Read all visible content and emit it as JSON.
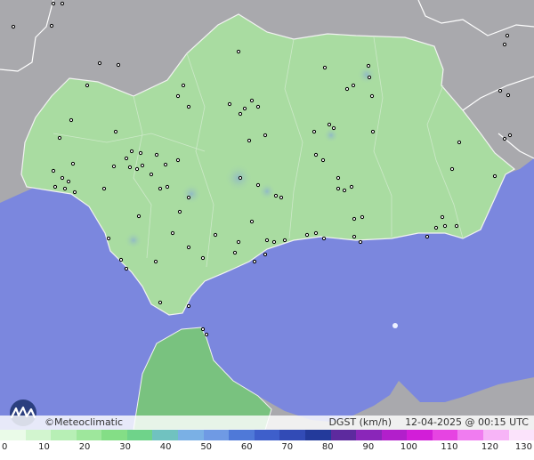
{
  "brand": "©Meteoclimatic",
  "parameter": "DGST (km/h)",
  "timestamp": "12-04-2025 @ 00:15 UTC",
  "colors": {
    "sea": "#7b87de",
    "land_outside": "#a9a9ad",
    "land_region": "#a9dca1",
    "land_region_dark": "#8fcb8c",
    "north_africa": "#79c27f",
    "station": "#000000"
  },
  "legend": {
    "ticks": [
      "0",
      "10",
      "20",
      "30",
      "40",
      "50",
      "60",
      "70",
      "80",
      "90",
      "100",
      "110",
      "120",
      "130"
    ],
    "colors": [
      "#eafbe8",
      "#d2f5cf",
      "#b7efb5",
      "#9ee79c",
      "#84de86",
      "#6fd38a",
      "#70c2c0",
      "#7ab0e5",
      "#6f9ae4",
      "#4f79d8",
      "#3e5fcb",
      "#324bb6",
      "#233a9b",
      "#5d2a9e",
      "#8a26b9",
      "#b21fcb",
      "#d21ed8",
      "#e644e2",
      "#f07cf0",
      "#f7b4f7",
      "#fbe3fb"
    ]
  }
}
